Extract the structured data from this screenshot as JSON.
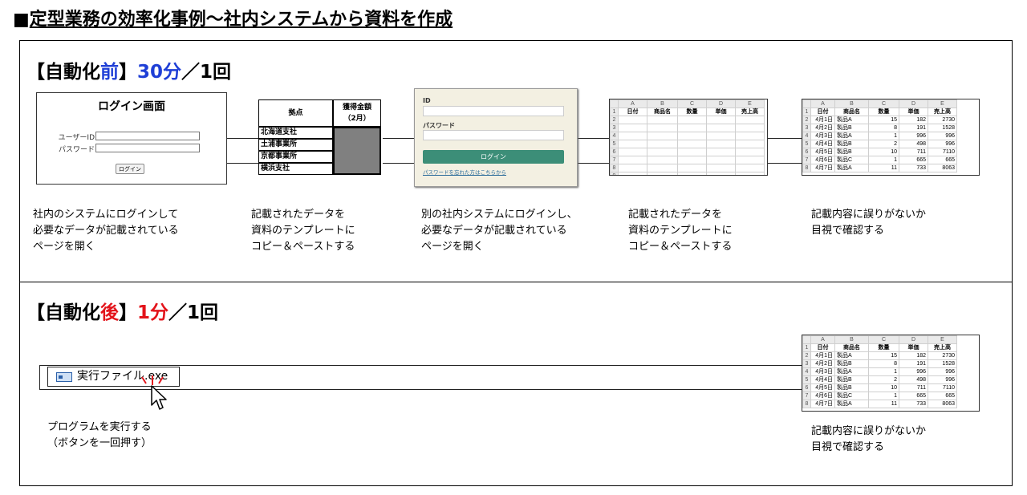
{
  "title": {
    "prefix": "■",
    "text": "定型業務の効率化事例～社内システムから資料を作成"
  },
  "before": {
    "label_a": "【自動化",
    "label_b": "前",
    "label_c": "】",
    "time": "30分",
    "per": "／1回",
    "login1": {
      "title": "ログイン画面",
      "user_label": "ユーザーID",
      "pass_label": "パスワード",
      "button": "ログイン"
    },
    "table": {
      "col1": "拠点",
      "col2a": "獲得金額",
      "col2b": "（2月）",
      "rows": [
        "北海道支社",
        "土浦事業所",
        "京都事業所",
        "横浜支社"
      ]
    },
    "login2": {
      "id_label": "ID",
      "pass_label": "パスワード",
      "button": "ログイン",
      "link": "パスワードを忘れた方はこちらから"
    },
    "steps": [
      [
        "社内のシステムにログインして",
        "必要なデータが記載されている",
        "ページを開く"
      ],
      [
        "記載されたデータを",
        "資料のテンプレートに",
        "コピー＆ペーストする"
      ],
      [
        "別の社内システムにログインし、",
        "必要なデータが記載されている",
        "ページを開く"
      ],
      [
        "記載されたデータを",
        "資料のテンプレートに",
        "コピー＆ペーストする"
      ],
      [
        "記載内容に誤りがないか",
        "目視で確認する"
      ]
    ]
  },
  "after": {
    "label_a": "【自動化",
    "label_b": "後",
    "label_c": "】",
    "time": "1分",
    "per": "／1回",
    "exe": "実行ファイル.exe",
    "step1": [
      "プログラムを実行する",
      "（ボタンを一回押す）"
    ],
    "step2": [
      "記載内容に誤りがないか",
      "目視で確認する"
    ]
  },
  "sheet": {
    "cols": [
      "A",
      "B",
      "C",
      "D",
      "E"
    ],
    "headers": [
      "日付",
      "商品名",
      "数量",
      "単価",
      "売上高"
    ],
    "rows": [
      [
        "4月1日",
        "製品A",
        "15",
        "182",
        "2730"
      ],
      [
        "4月2日",
        "製品B",
        "8",
        "191",
        "1528"
      ],
      [
        "4月3日",
        "製品A",
        "1",
        "996",
        "996"
      ],
      [
        "4月4日",
        "製品B",
        "2",
        "498",
        "996"
      ],
      [
        "4月5日",
        "製品B",
        "10",
        "711",
        "7110"
      ],
      [
        "4月6日",
        "製品C",
        "1",
        "665",
        "665"
      ],
      [
        "4月7日",
        "製品A",
        "11",
        "733",
        "8063"
      ]
    ]
  },
  "colors": {
    "accent_blue": "#1f3fd6",
    "accent_red": "#e3141b",
    "button_green": "#3c8e78"
  }
}
